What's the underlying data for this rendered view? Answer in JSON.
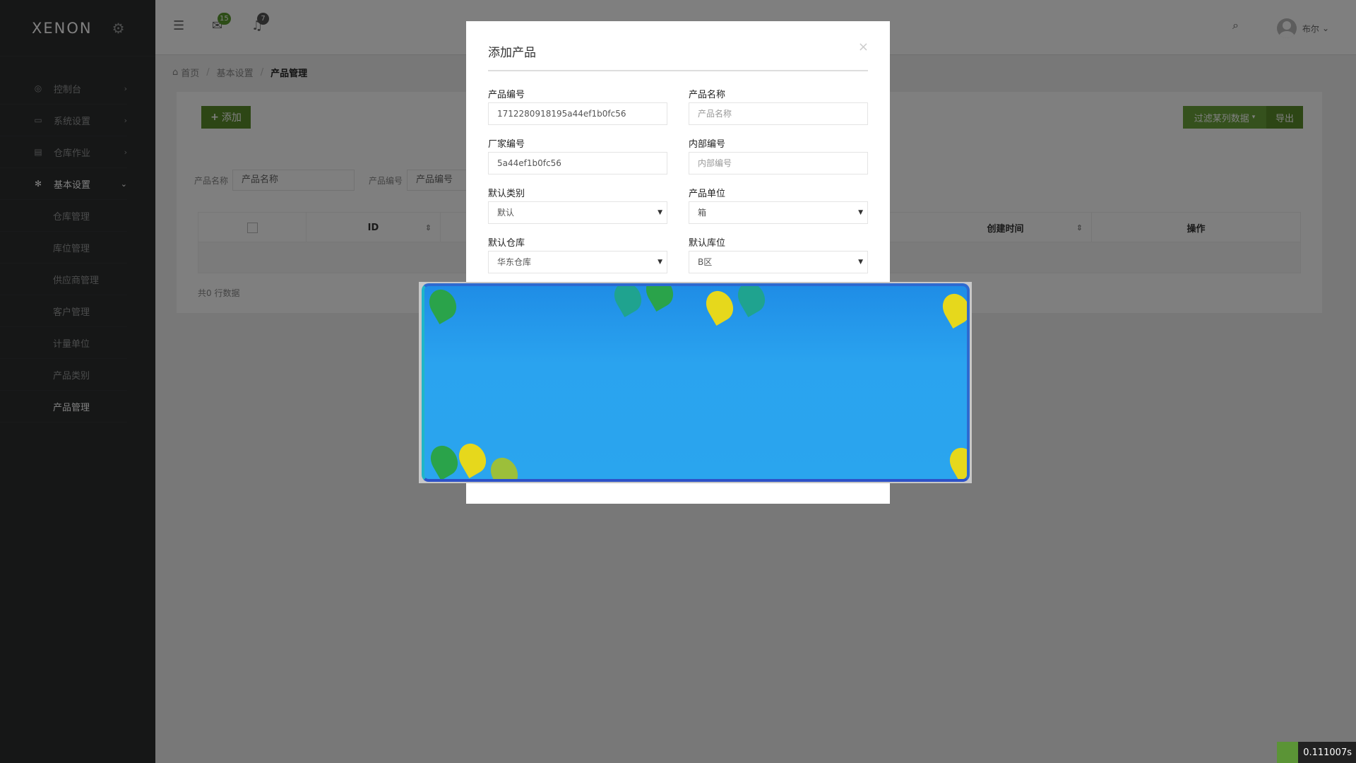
{
  "sidebar": {
    "brand": "XENON",
    "menu": [
      {
        "label": "控制台",
        "icon": "dashboard-icon"
      },
      {
        "label": "系统设置",
        "icon": "desktop-icon"
      },
      {
        "label": "仓库作业",
        "icon": "document-icon"
      },
      {
        "label": "基本设置",
        "icon": "settings-icon"
      }
    ],
    "submenu": [
      "仓库管理",
      "库位管理",
      "供应商管理",
      "客户管理",
      "计量单位",
      "产品类别",
      "产品管理"
    ]
  },
  "topbar": {
    "messages_badge": "15",
    "notifications_badge": "7",
    "user_name": "布尔"
  },
  "breadcrumb": {
    "home": "首页",
    "section": "基本设置",
    "current": "产品管理"
  },
  "panel": {
    "add_label": "添加",
    "filter_label": "过滤某列数据",
    "export_label": "导出",
    "search": {
      "name_label": "产品名称",
      "name_placeholder": "产品名称",
      "code_label": "产品编号",
      "code_placeholder": "产品编号"
    },
    "table": {
      "col_id": "ID",
      "col_created": "创建时间",
      "col_action": "操作"
    },
    "count_text": "共0 行数据"
  },
  "modal": {
    "title": "添加产品",
    "close": "×",
    "fields": {
      "product_code_label": "产品编号",
      "product_code_value": "1712280918195a44ef1b0fc56",
      "product_name_label": "产品名称",
      "product_name_placeholder": "产品名称",
      "vendor_code_label": "厂家编号",
      "vendor_code_value": "5a44ef1b0fc56",
      "internal_code_label": "内部编号",
      "internal_code_placeholder": "内部编号",
      "default_category_label": "默认类别",
      "default_category_value": "默认",
      "unit_label": "产品单位",
      "unit_value": "箱",
      "default_warehouse_label": "默认仓库",
      "default_warehouse_value": "华东仓库",
      "default_location_label": "默认库位",
      "default_location_value": "B区"
    }
  },
  "perf": {
    "time": "0.111007s"
  },
  "colors": {
    "sidebar_bg": "#2c2e2f",
    "accent_green": "#5b8c2a",
    "badge_green": "#5b9b2e",
    "badge_gray": "#555555"
  }
}
